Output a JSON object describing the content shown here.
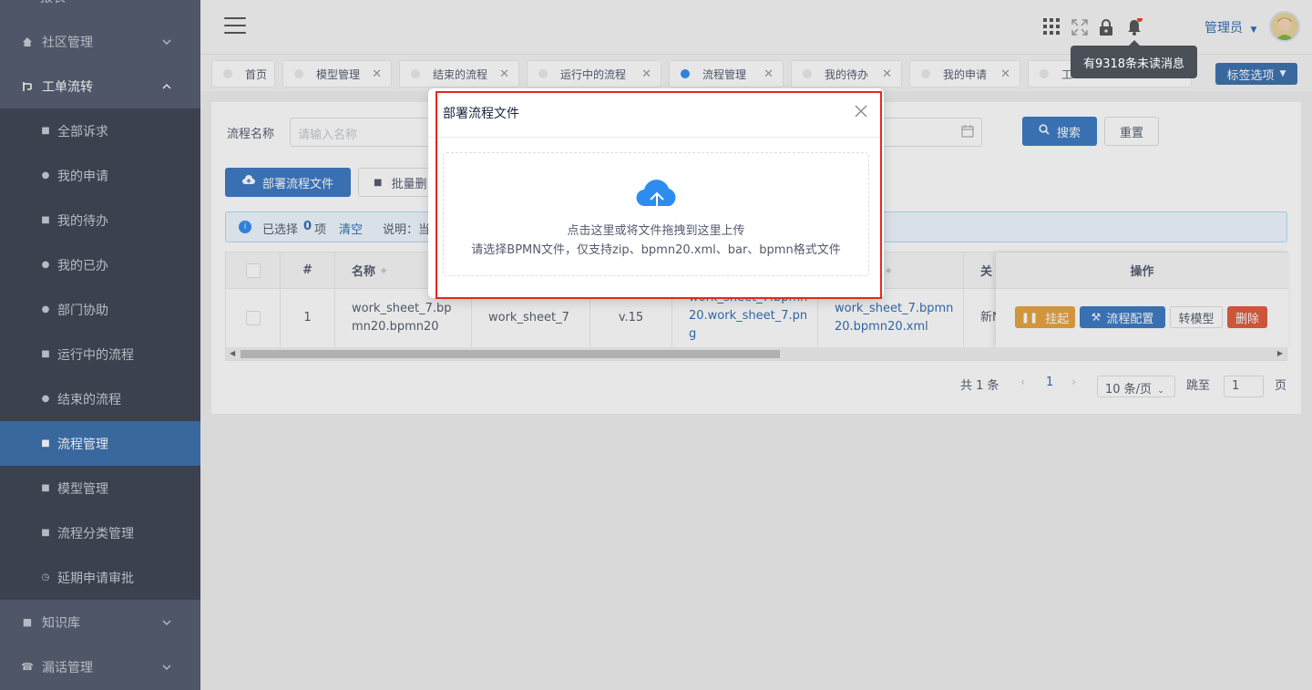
{
  "sidebar": {
    "top_partial": "报表",
    "menus": [
      {
        "label": "社区管理",
        "icon": "home-icon"
      },
      {
        "label": "工单流转",
        "icon": "flow-icon"
      }
    ],
    "submenu": [
      {
        "label": "全部诉求"
      },
      {
        "label": "我的申请"
      },
      {
        "label": "我的待办"
      },
      {
        "label": "我的已办"
      },
      {
        "label": "部门协助"
      },
      {
        "label": "运行中的流程"
      },
      {
        "label": "结束的流程"
      },
      {
        "label": "流程管理"
      },
      {
        "label": "模型管理"
      },
      {
        "label": "流程分类管理"
      },
      {
        "label": "延期申请审批"
      }
    ],
    "bottom_menus": [
      {
        "label": "知识库"
      },
      {
        "label": "漏话管理"
      }
    ]
  },
  "header": {
    "admin": "管理员",
    "tooltip": "有9318条未读消息"
  },
  "tabs": [
    {
      "label": "首页"
    },
    {
      "label": "模型管理"
    },
    {
      "label": "结束的流程"
    },
    {
      "label": "运行中的流程"
    },
    {
      "label": "流程管理"
    },
    {
      "label": "我的待办"
    },
    {
      "label": "我的申请"
    },
    {
      "label": "工"
    }
  ],
  "tag_options": "标签选项",
  "search": {
    "label": "流程名称",
    "placeholder": "请输入名称",
    "search_btn": "搜索",
    "reset_btn": "重置"
  },
  "toolbar": {
    "deploy": "部署流程文件",
    "batch_delete": "批量删"
  },
  "alert": {
    "selected_prefix": "已选择",
    "count": "0",
    "suffix": "项",
    "clear": "清空",
    "note": "说明：当"
  },
  "table": {
    "headers": {
      "idx": "#",
      "name": "名称",
      "col6": "",
      "col7": "关",
      "op": "操作"
    },
    "row": {
      "idx": "1",
      "name": "work_sheet_7.bpmn20.bpmn20",
      "key": "work_sheet_7",
      "version": "v.15",
      "image": "work_sheet_7.bpmn20.work_sheet_7.png",
      "xml": "work_sheet_7.bpmn20.bpmn20.xml",
      "col7": "新Ne"
    },
    "ops": {
      "suspend": "挂起",
      "config": "流程配置",
      "to_model": "转模型",
      "delete": "删除"
    }
  },
  "pager": {
    "total": "共 1 条",
    "page": "1",
    "size": "10 条/页",
    "goto": "跳至",
    "goto_value": "1",
    "page_suffix": "页"
  },
  "modal": {
    "title": "部署流程文件",
    "upload_hint": "点击这里或将文件拖拽到这里上传",
    "upload_desc": "请选择BPMN文件，仅支持zip、bpmn20.xml、bar、bpmn格式文件"
  },
  "colors": {
    "sidebar": "#515a6e",
    "active": "#3a6fae",
    "primary": "#3a78c3",
    "warning": "#e6a23c",
    "danger": "#e05a3a",
    "highlight": "#e8261d"
  }
}
